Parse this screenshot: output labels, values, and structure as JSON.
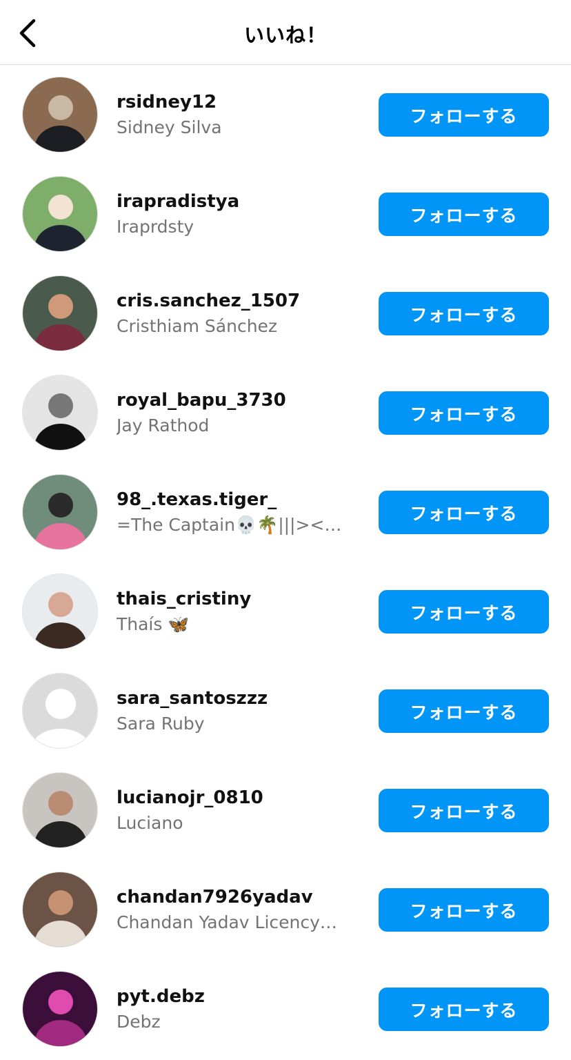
{
  "header": {
    "title": "いいね！",
    "back_icon": "chevron-left-icon"
  },
  "follow_label": "フォローする",
  "accent_color": "#0095f6",
  "users": [
    {
      "username": "rsidney12",
      "fullname": "Sidney Silva",
      "avatar_colors": [
        "#8a6b52",
        "#1d1d24",
        "#c9b8a4"
      ]
    },
    {
      "username": "irapradistya",
      "fullname": "Iraprdsty",
      "avatar_colors": [
        "#7fae6a",
        "#1f2530",
        "#f2e3d2"
      ]
    },
    {
      "username": "cris.sanchez_1507",
      "fullname": "Cristhiam Sánchez",
      "avatar_colors": [
        "#4a5a4c",
        "#7a2b3e",
        "#d09a7a"
      ]
    },
    {
      "username": "royal_bapu_3730",
      "fullname": "Jay Rathod",
      "avatar_colors": [
        "#e4e4e4",
        "#111111",
        "#777777"
      ]
    },
    {
      "username": "98_.texas.tiger_",
      "fullname": "=The Captain💀🌴|||><…",
      "avatar_colors": [
        "#6f8d7a",
        "#e7739f",
        "#2a2a2a"
      ]
    },
    {
      "username": "thais_cristiny",
      "fullname": "Thaís 🦋",
      "avatar_colors": [
        "#e9ecef",
        "#3a2a22",
        "#d8a896"
      ]
    },
    {
      "username": "sara_santoszzz",
      "fullname": "Sara Ruby",
      "avatar_colors": [
        "#dbdbdb",
        "#ffffff",
        "#ffffff"
      ]
    },
    {
      "username": "lucianojr_0810",
      "fullname": "Luciano",
      "avatar_colors": [
        "#c8c4c0",
        "#222222",
        "#b98c73"
      ]
    },
    {
      "username": "chandan7926yadav",
      "fullname": "Chandan Yadav Licency…",
      "avatar_colors": [
        "#6b5346",
        "#e5dcd3",
        "#c79272"
      ]
    },
    {
      "username": "pyt.debz",
      "fullname": "Debz",
      "avatar_colors": [
        "#3b0f3a",
        "#a02a7e",
        "#e04bb0"
      ]
    }
  ]
}
